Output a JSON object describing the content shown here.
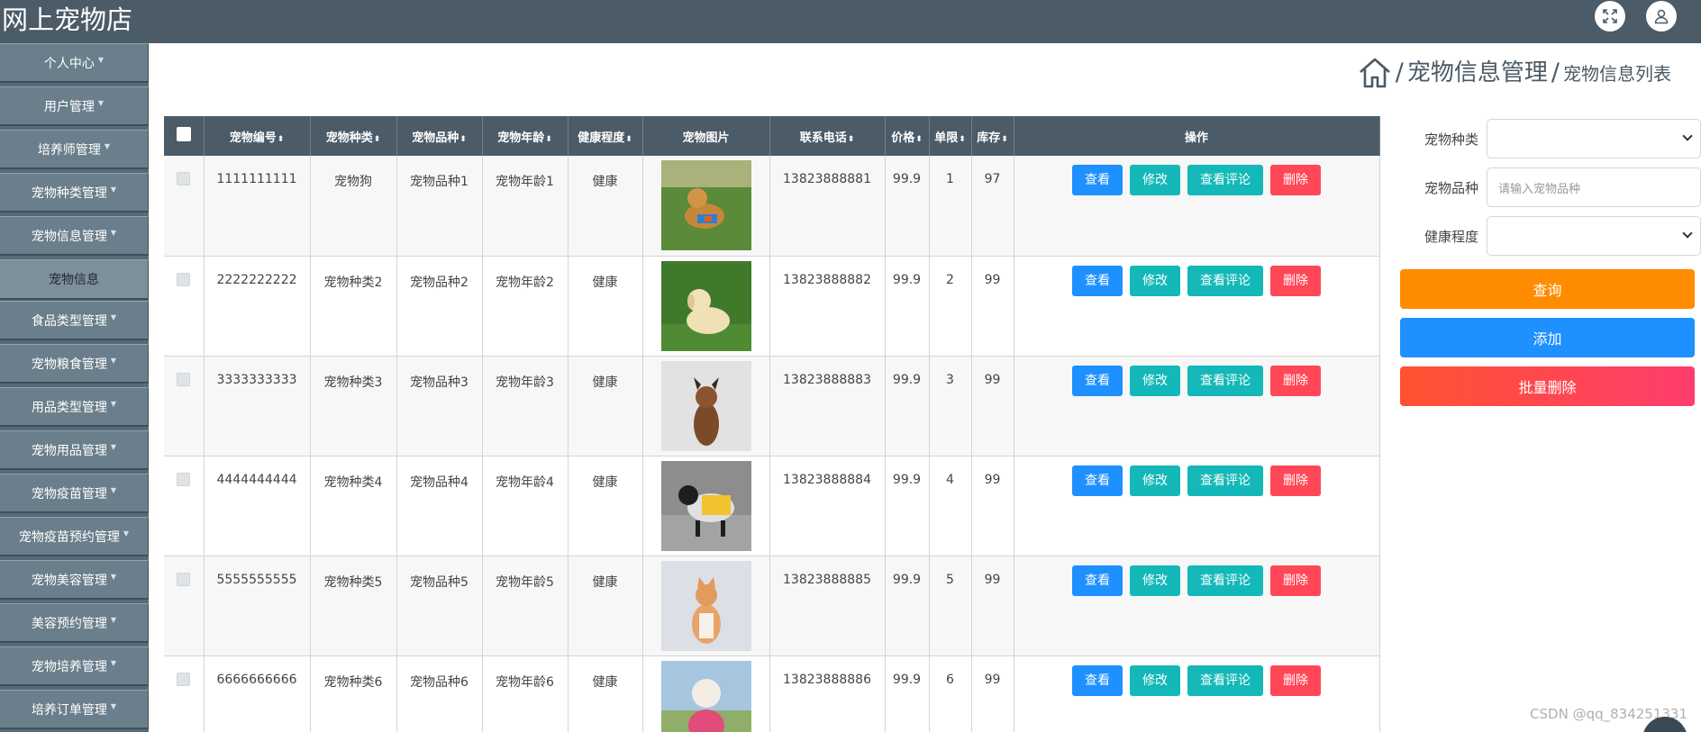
{
  "app": {
    "title": "网上宠物店"
  },
  "sidebar": {
    "items": [
      {
        "label": "个人中心"
      },
      {
        "label": "用户管理"
      },
      {
        "label": "培养师管理"
      },
      {
        "label": "宠物种类管理"
      },
      {
        "label": "宠物信息管理"
      },
      {
        "label": "宠物信息"
      },
      {
        "label": "食品类型管理"
      },
      {
        "label": "宠物粮食管理"
      },
      {
        "label": "用品类型管理"
      },
      {
        "label": "宠物用品管理"
      },
      {
        "label": "宠物疫苗管理"
      },
      {
        "label": "宠物疫苗预约管理"
      },
      {
        "label": "宠物美容管理"
      },
      {
        "label": "美容预约管理"
      },
      {
        "label": "宠物培养管理"
      },
      {
        "label": "培养订单管理"
      }
    ]
  },
  "breadcrumb": {
    "sep": "/",
    "level1": "宠物信息管理",
    "level2": "宠物信息列表"
  },
  "table": {
    "headers": {
      "id": "宠物编号",
      "category": "宠物种类",
      "breed": "宠物品种",
      "age": "宠物年龄",
      "health": "健康程度",
      "image": "宠物图片",
      "phone": "联系电话",
      "price": "价格",
      "limit": "单限",
      "stock": "库存",
      "ops": "操作"
    },
    "sort_glyph": "⬍",
    "actions": {
      "view": "查看",
      "edit": "修改",
      "comments": "查看评论",
      "delete": "删除"
    },
    "rows": [
      {
        "id": "1111111111",
        "category": "宠物狗",
        "breed": "宠物品种1",
        "age": "宠物年龄1",
        "health": "健康",
        "phone": "13823888881",
        "price": "99.9",
        "limit": "1",
        "stock": "97"
      },
      {
        "id": "2222222222",
        "category": "宠物种类2",
        "breed": "宠物品种2",
        "age": "宠物年龄2",
        "health": "健康",
        "phone": "13823888882",
        "price": "99.9",
        "limit": "2",
        "stock": "99"
      },
      {
        "id": "3333333333",
        "category": "宠物种类3",
        "breed": "宠物品种3",
        "age": "宠物年龄3",
        "health": "健康",
        "phone": "13823888883",
        "price": "99.9",
        "limit": "3",
        "stock": "99"
      },
      {
        "id": "4444444444",
        "category": "宠物种类4",
        "breed": "宠物品种4",
        "age": "宠物年龄4",
        "health": "健康",
        "phone": "13823888884",
        "price": "99.9",
        "limit": "4",
        "stock": "99"
      },
      {
        "id": "5555555555",
        "category": "宠物种类5",
        "breed": "宠物品种5",
        "age": "宠物年龄5",
        "health": "健康",
        "phone": "13823888885",
        "price": "99.9",
        "limit": "5",
        "stock": "99"
      },
      {
        "id": "6666666666",
        "category": "宠物种类6",
        "breed": "宠物品种6",
        "age": "宠物年龄6",
        "health": "健康",
        "phone": "13823888886",
        "price": "99.9",
        "limit": "6",
        "stock": "99"
      }
    ]
  },
  "search": {
    "category_label": "宠物种类",
    "breed_label": "宠物品种",
    "breed_placeholder": "请输入宠物品种",
    "health_label": "健康程度",
    "query_button": "查询",
    "add_button": "添加",
    "batch_delete_button": "批量删除"
  },
  "watermark": "CSDN @qq_834251331"
}
